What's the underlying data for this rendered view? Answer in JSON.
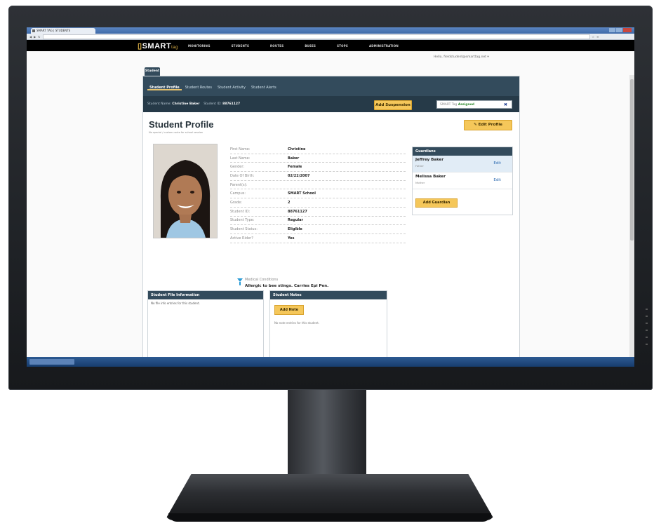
{
  "browser": {
    "tab_title": "SMART TAG | STUDENTS",
    "address": ""
  },
  "app": {
    "logo_text": "SMART",
    "logo_tm": "tag",
    "nav": [
      "MONITORING",
      "STUDENTS",
      "ROUTES",
      "BUSES",
      "STOPS",
      "ADMINISTRATION"
    ],
    "user_line": "Hello, fieldstudent@smarttag.net"
  },
  "breadcrumb": "Student",
  "subtabs": [
    "Student Profile",
    "Student Routes",
    "Student Activity",
    "Student Alerts"
  ],
  "infobar": {
    "name_label": "Student Name:",
    "name_value": "Christine Baker",
    "id_label": "Student ID:",
    "id_value": "88761127"
  },
  "buttons": {
    "add_suspension": "Add Suspension",
    "edit_profile": "Edit Profile",
    "add_guardian": "Add Guardian",
    "add_note": "Add Note"
  },
  "smarttag": {
    "label": "SMART Tag",
    "status": "Assigned",
    "remove": "✖"
  },
  "page": {
    "title": "Student Profile",
    "subtitle": "No special / custom route for school session"
  },
  "profile_fields": [
    {
      "label": "First Name:",
      "value": "Christine"
    },
    {
      "label": "Last Name:",
      "value": "Baker"
    },
    {
      "label": "Gender:",
      "value": "Female"
    },
    {
      "label": "Date Of Birth:",
      "value": "02/22/2007"
    },
    {
      "label": "Parent(s):",
      "value": ""
    },
    {
      "label": "Campus:",
      "value": "SMART School"
    },
    {
      "label": "Grade:",
      "value": "2"
    },
    {
      "label": "Student ID:",
      "value": "88761127"
    },
    {
      "label": "Student Type:",
      "value": "Regular"
    },
    {
      "label": "Student Status:",
      "value": "Eligible"
    },
    {
      "label": "Active Rider?",
      "value": "Yes"
    }
  ],
  "medical": {
    "label": "Medical Conditions",
    "value": "Allergic to bee stings. Carries Epi Pen."
  },
  "guardians": {
    "title": "Guardians",
    "items": [
      {
        "name": "Jeffrey Baker",
        "relation": "Father",
        "edit": "Edit"
      },
      {
        "name": "Melissa Baker",
        "relation": "Mother",
        "edit": "Edit"
      }
    ]
  },
  "file_info": {
    "title": "Student File Information",
    "empty": "No file info entries for this student."
  },
  "notes": {
    "title": "Student Notes",
    "empty": "No note entries for this student."
  },
  "colors": {
    "header_dark": "#334b5c",
    "accent_button": "#f5c75a",
    "nav_bg": "#000000"
  }
}
